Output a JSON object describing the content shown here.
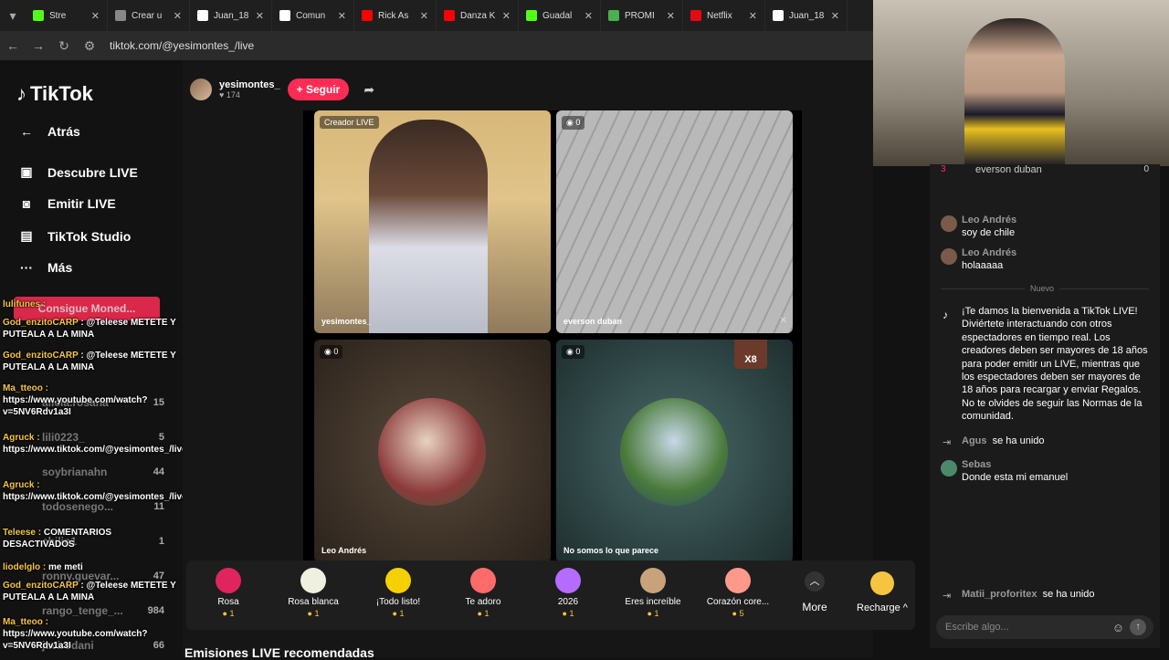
{
  "browser": {
    "tabs": [
      {
        "label": "Stre",
        "color": "#53fc18"
      },
      {
        "label": "Crear u",
        "color": "#888"
      },
      {
        "label": "Juan_18",
        "color": "#fff"
      },
      {
        "label": "Comun",
        "color": "#fff"
      },
      {
        "label": "Rick As",
        "color": "#ff0000"
      },
      {
        "label": "Danza K",
        "color": "#ff0000"
      },
      {
        "label": "Guadal",
        "color": "#53fc18"
      },
      {
        "label": "PROMI",
        "color": "#4caf50"
      },
      {
        "label": "Netflix",
        "color": "#e50914"
      },
      {
        "label": "Juan_18",
        "color": "#fff"
      }
    ],
    "url": "tiktok.com/@yesimontes_/live"
  },
  "sidebar": {
    "logo": "TikTok",
    "items": [
      {
        "label": "Atrás",
        "icon": "←"
      },
      {
        "label": "Descubre LIVE",
        "icon": "▣"
      },
      {
        "label": "Emitir LIVE",
        "icon": "◙"
      },
      {
        "label": "TikTok Studio",
        "icon": "▤"
      },
      {
        "label": "Más",
        "icon": "···"
      }
    ],
    "moned": "Consigue Moned..."
  },
  "overlay_chat": [
    {
      "name": "lulifunes :",
      "text": ""
    },
    {
      "name": "God_enzitoCARP",
      "text": ": @Teleese METETE Y PUTEALA A LA MINA"
    },
    {
      "name": "God_enzitoCARP",
      "text": ": @Teleese METETE Y PUTEALA A LA MINA"
    },
    {
      "name": "Ma_tteoo :",
      "text": "https://www.youtube.com/watch?v=5NV6Rdv1a3I"
    },
    {
      "name": "Agruck :",
      "text": "https://www.tiktok.com/@yesimontes_/live"
    },
    {
      "name": "Agruck :",
      "text": "https://www.tiktok.com/@yesimontes_/live"
    },
    {
      "name": "Teleese :",
      "text": "COMENTARIOS DESACTIVADOS"
    },
    {
      "name": "liodelglo :",
      "text": "me meti"
    },
    {
      "name": "God_enzitoCARP",
      "text": ": @Teleese METETE Y PUTEALA A LA MINA"
    },
    {
      "name": "Ma_tteoo :",
      "text": "https://www.youtube.com/watch?v=5NV6Rdv1a3I"
    }
  ],
  "ghost_list": [
    {
      "name": "alicia.rosana",
      "num": "15"
    },
    {
      "name": "lili0223_",
      "num": "5"
    },
    {
      "name": "soybrianahn",
      "num": "44"
    },
    {
      "name": "todosenego...",
      "num": "11"
    },
    {
      "name": "chilin1",
      "num": "1"
    },
    {
      "name": "ronny.guevar...",
      "num": "47"
    },
    {
      "name": "rango_tenge_...",
      "num": "984"
    },
    {
      "name": "javirodani",
      "num": "66"
    }
  ],
  "host": {
    "name": "yesimontes_",
    "viewers": "♥ 174",
    "follow": "+ Seguir"
  },
  "tiles": [
    {
      "top": "Creador LIVE",
      "bottom": "yesimontes_"
    },
    {
      "top": "◉ 0",
      "bottom": "everson duban"
    },
    {
      "top": "◉ 0",
      "bottom": "Leo Andrés"
    },
    {
      "top": "◉ 0",
      "bottom": "No somos lo que parece"
    }
  ],
  "badge_x8": "X8",
  "gifts": [
    {
      "name": "Rosa",
      "price": "1",
      "color": "#e0245e"
    },
    {
      "name": "Rosa blanca",
      "price": "1",
      "color": "#f0f0e0"
    },
    {
      "name": "¡Todo listo!",
      "price": "1",
      "color": "#f5d000"
    },
    {
      "name": "Te adoro",
      "price": "1",
      "color": "#ff6b6b"
    },
    {
      "name": "2026",
      "price": "1",
      "color": "#b66bff"
    },
    {
      "name": "Eres increíble",
      "price": "1",
      "color": "#c8a27a"
    },
    {
      "name": "Corazón core...",
      "price": "5",
      "color": "#ff9a8b"
    }
  ],
  "more": "More",
  "recharge": "Recharge",
  "recommended": "Emisiones LIVE recomendadas",
  "chat": {
    "top_rank": "3",
    "top_user": "everson duban",
    "top_score": "0",
    "messages": [
      {
        "user": "Leo Andrés",
        "text": "soy de chile"
      },
      {
        "user": "Leo Andrés",
        "text": "holaaaaa"
      }
    ],
    "nuevo": "Nuevo",
    "welcome": "¡Te damos la bienvenida a TikTok LIVE! Diviértete interactuando con otros espectadores en tiempo real. Los creadores deben ser mayores de 18 años para poder emitir un LIVE, mientras que los espectadores deben ser mayores de 18 años para recargar y enviar Regalos. No te olvides de seguir las Normas de la comunidad.",
    "join1_user": "Agus",
    "join1_text": "se ha unido",
    "sebas_user": "Sebas",
    "sebas_text": "Donde esta mi emanuel",
    "join2_user": "Matii_proforitex",
    "join2_text": "se ha unido",
    "input_placeholder": "Escribe algo..."
  }
}
